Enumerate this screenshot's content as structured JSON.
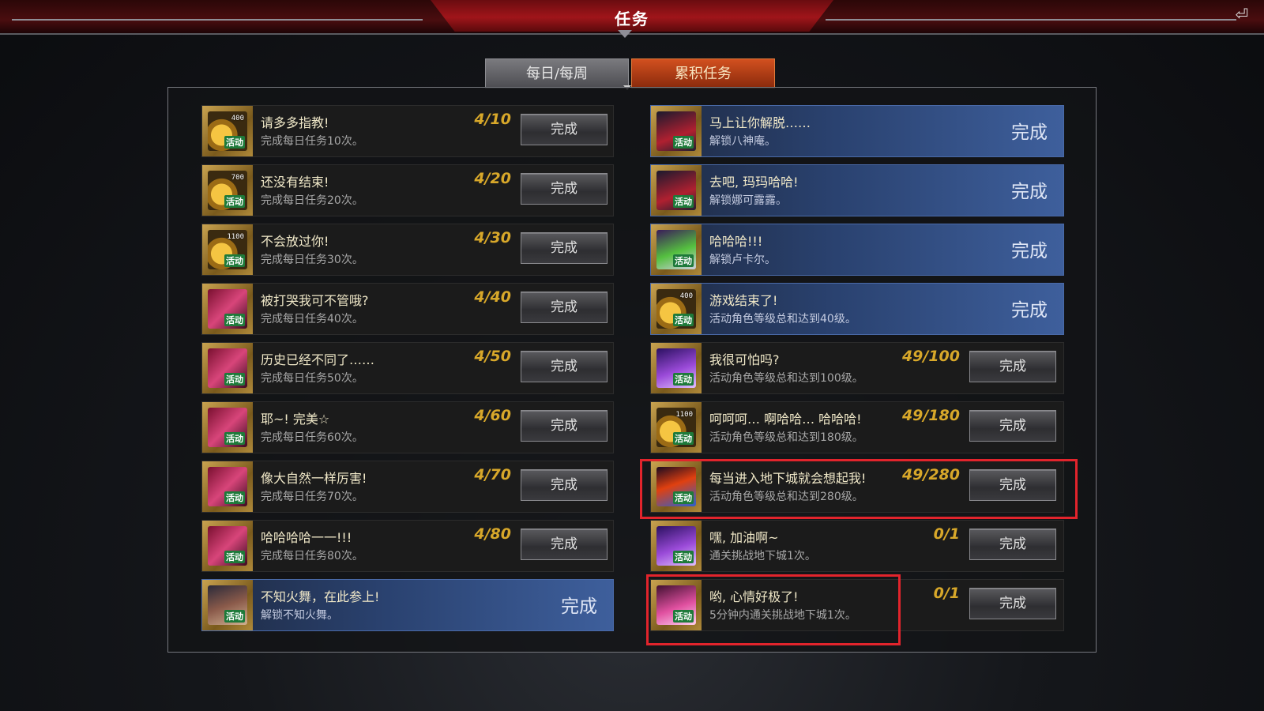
{
  "header": {
    "title": "任务"
  },
  "tabs": [
    {
      "label": "每日/每周",
      "active": false
    },
    {
      "label": "累积任务",
      "active": true
    }
  ],
  "button_label": "完成",
  "left_rows": [
    {
      "icon": "coin-reward-icon",
      "icon_num": "400",
      "title": "请多多指教!",
      "desc": "完成每日任务10次。",
      "progress": "4/10",
      "done": false
    },
    {
      "icon": "coin-reward-icon",
      "icon_num": "700",
      "title": "还没有结束!",
      "desc": "完成每日任务20次。",
      "progress": "4/20",
      "done": false
    },
    {
      "icon": "coin-reward-icon",
      "icon_num": "1100",
      "title": "不会放过你!",
      "desc": "完成每日任务30次。",
      "progress": "4/30",
      "done": false
    },
    {
      "icon": "picture-card-icon",
      "icon_num": "",
      "title": "被打哭我可不管哦?",
      "desc": "完成每日任务40次。",
      "progress": "4/40",
      "done": false
    },
    {
      "icon": "picture-card-icon",
      "icon_num": "",
      "title": "历史已经不同了……",
      "desc": "完成每日任务50次。",
      "progress": "4/50",
      "done": false
    },
    {
      "icon": "picture-card-icon",
      "icon_num": "",
      "title": "耶~! 完美☆",
      "desc": "完成每日任务60次。",
      "progress": "4/60",
      "done": false
    },
    {
      "icon": "picture-card-icon",
      "icon_num": "",
      "title": "像大自然一样厉害!",
      "desc": "完成每日任务70次。",
      "progress": "4/70",
      "done": false
    },
    {
      "icon": "picture-card-icon",
      "icon_num": "",
      "title": "哈哈哈哈一一!!!",
      "desc": "完成每日任务80次。",
      "progress": "4/80",
      "done": false
    },
    {
      "icon": "dancer-portrait-icon",
      "icon_num": "",
      "title": "不知火舞，在此参上!",
      "desc": "解锁不知火舞。",
      "progress": "",
      "done": true
    }
  ],
  "right_rows": [
    {
      "icon": "character-portrait-icon",
      "icon_num": "",
      "title": "马上让你解脱……",
      "desc": "解锁八神庵。",
      "progress": "",
      "done": true
    },
    {
      "icon": "character-portrait-icon",
      "icon_num": "",
      "title": "去吧, 玛玛哈哈!",
      "desc": "解锁娜可露露。",
      "progress": "",
      "done": true
    },
    {
      "icon": "gift-box-icon",
      "icon_num": "",
      "title": "哈哈哈!!!",
      "desc": "解锁卢卡尔。",
      "progress": "",
      "done": true
    },
    {
      "icon": "coin-reward-icon",
      "icon_num": "400",
      "title": "游戏结束了!",
      "desc": "活动角色等级总和达到40级。",
      "progress": "",
      "done": true
    },
    {
      "icon": "treasure-chest-icon",
      "icon_num": "",
      "title": "我很可怕吗?",
      "desc": "活动角色等级总和达到100级。",
      "progress": "49/100",
      "done": false
    },
    {
      "icon": "coin-reward-icon",
      "icon_num": "1100",
      "title": "呵呵呵… 啊哈哈… 哈哈哈!",
      "desc": "活动角色等级总和达到180级。",
      "progress": "49/180",
      "done": false
    },
    {
      "icon": "sword-icon",
      "icon_num": "",
      "title": "每当进入地下城就会想起我!",
      "desc": "活动角色等级总和达到280级。",
      "progress": "49/280",
      "done": false
    },
    {
      "icon": "treasure-chest-icon",
      "icon_num": "",
      "title": "嘿, 加油啊~",
      "desc": "通关挑战地下城1次。",
      "progress": "0/1",
      "done": false
    },
    {
      "icon": "heart-chest-icon",
      "icon_num": "",
      "title": "哟, 心情好极了!",
      "desc": "5分钟内通关挑战地下城1次。",
      "progress": "0/1",
      "done": false
    }
  ],
  "icon_badge": "活动",
  "highlight_color": "#e2242c",
  "accent_gold": "#d8a82a",
  "done_blue": "#3e5f9c"
}
